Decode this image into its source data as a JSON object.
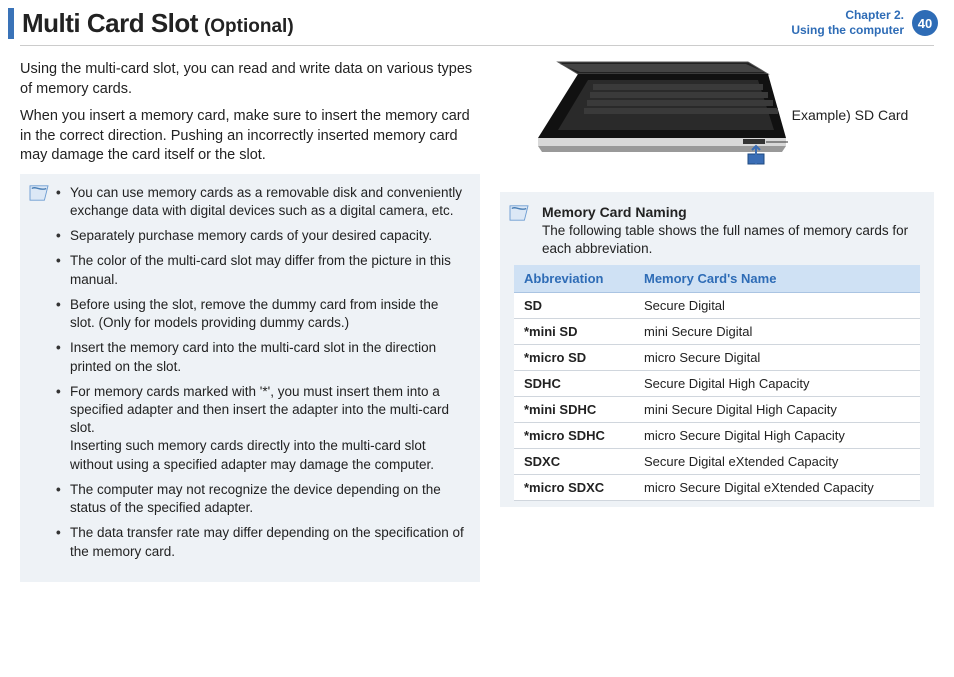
{
  "header": {
    "title_main": "Multi Card Slot",
    "title_sub": "(Optional)",
    "chapter_line1": "Chapter 2.",
    "chapter_line2": "Using the computer",
    "page_number": "40"
  },
  "intro": {
    "p1": "Using the multi-card slot, you can read and write data on various types of memory cards.",
    "p2": "When you insert a memory card, make sure to insert the memory card in the correct direction. Pushing an incorrectly inserted memory card may damage the card itself or the slot."
  },
  "notes": [
    "You can use memory cards as a removable disk and conveniently exchange data with digital devices such as a digital camera, etc.",
    "Separately purchase memory cards of your desired capacity.",
    "The color of the multi-card slot may differ from the picture in this manual.",
    "Before using the slot, remove the dummy card from inside the slot. (Only for models providing dummy cards.)",
    "Insert the memory card into the multi-card slot in the direction printed on the slot.",
    "For memory cards marked with '*', you must insert them into a specified adapter and then insert the adapter into the multi-card slot.",
    "The computer may not recognize the device depending on the status of the specified adapter.",
    "The data transfer rate may differ depending on the specification of the memory card."
  ],
  "note5_sub": "Inserting such memory cards directly into the multi-card slot without using a specified adapter may damage the computer.",
  "figure": {
    "caption": "Example) SD Card"
  },
  "naming": {
    "title": "Memory Card Naming",
    "desc": "The following table shows the full names of memory cards for each abbreviation.",
    "col_abbrev": "Abbreviation",
    "col_name": "Memory Card's Name",
    "rows": [
      {
        "abbrev": "SD",
        "name": "Secure Digital"
      },
      {
        "abbrev": "*mini SD",
        "name": "mini Secure Digital"
      },
      {
        "abbrev": "*micro SD",
        "name": "micro Secure Digital"
      },
      {
        "abbrev": "SDHC",
        "name": "Secure Digital High Capacity"
      },
      {
        "abbrev": "*mini SDHC",
        "name": "mini Secure Digital High Capacity"
      },
      {
        "abbrev": "*micro SDHC",
        "name": "micro Secure Digital High Capacity"
      },
      {
        "abbrev": "SDXC",
        "name": "Secure Digital eXtended Capacity"
      },
      {
        "abbrev": "*micro SDXC",
        "name": "micro Secure Digital eXtended Capacity"
      }
    ]
  }
}
